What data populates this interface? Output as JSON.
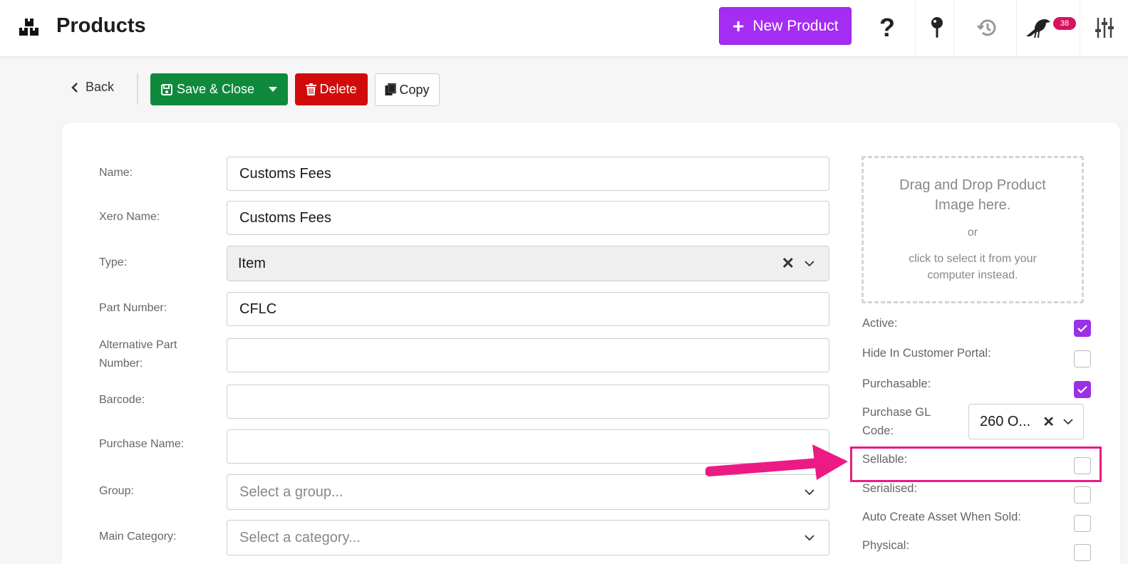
{
  "header": {
    "title": "Products",
    "new_button_label": "New Product",
    "notification_count": "38",
    "icons": [
      "boxes-logo-icon",
      "help-question-icon",
      "pin-icon",
      "history-icon",
      "bird-icon",
      "sliders-icon"
    ]
  },
  "toolbar": {
    "back_label": "Back",
    "save_label": "Save & Close",
    "delete_label": "Delete",
    "copy_label": "Copy"
  },
  "form": {
    "name": {
      "label": "Name:",
      "value": "Customs Fees"
    },
    "xero_name": {
      "label": "Xero Name:",
      "value": "Customs Fees"
    },
    "type": {
      "label": "Type:",
      "value": "Item"
    },
    "part_number": {
      "label": "Part Number:",
      "value": "CFLC"
    },
    "alt_part_number": {
      "label": "Alternative Part Number:",
      "value": ""
    },
    "barcode": {
      "label": "Barcode:",
      "value": ""
    },
    "purchase_name": {
      "label": "Purchase Name:",
      "value": ""
    },
    "group": {
      "label": "Group:",
      "placeholder": "Select a group..."
    },
    "main_category": {
      "label": "Main Category:",
      "placeholder": "Select a category..."
    }
  },
  "image_drop": {
    "title": "Drag and Drop Product Image here.",
    "or": "or",
    "hint": "click to select it from your computer instead."
  },
  "options": {
    "active": {
      "label": "Active:",
      "checked": true
    },
    "hide_in_portal": {
      "label": "Hide In Customer Portal:",
      "checked": false
    },
    "purchasable": {
      "label": "Purchasable:",
      "checked": true
    },
    "purchase_gl_code": {
      "label": "Purchase GL Code:",
      "value": "260 O..."
    },
    "sellable": {
      "label": "Sellable:",
      "checked": false
    },
    "serialised": {
      "label": "Serialised:",
      "checked": false
    },
    "auto_create_asset": {
      "label": "Auto Create Asset When Sold:",
      "checked": false
    },
    "physical": {
      "label": "Physical:",
      "checked": false
    }
  },
  "colors": {
    "accent": "#a52cf2",
    "save": "#0f8a3c",
    "delete": "#d10b0b",
    "annotation": "#ec1a85"
  }
}
